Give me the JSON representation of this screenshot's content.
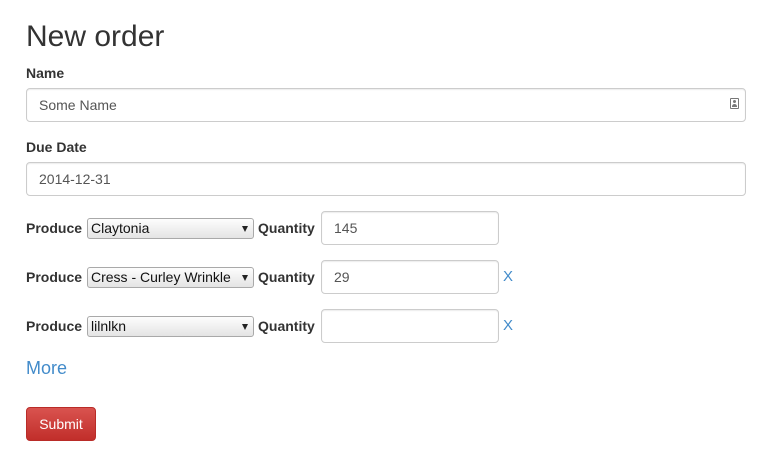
{
  "page": {
    "title": "New order"
  },
  "name_field": {
    "label": "Name",
    "value": "Some Name",
    "icon": "contact-card-icon"
  },
  "due_date_field": {
    "label": "Due Date",
    "value": "2014-12-31"
  },
  "produce_rows": [
    {
      "produce_label": "Produce",
      "produce_selected": "Claytonia",
      "quantity_label": "Quantity",
      "quantity_value": "145",
      "remove_label": ""
    },
    {
      "produce_label": "Produce",
      "produce_selected": "Cress - Curley Wrinkle",
      "quantity_label": "Quantity",
      "quantity_value": "29",
      "remove_label": "X"
    },
    {
      "produce_label": "Produce",
      "produce_selected": "lilnlkn",
      "quantity_label": "Quantity",
      "quantity_value": "",
      "remove_label": "X"
    }
  ],
  "more_link": {
    "label": "More"
  },
  "submit_button": {
    "label": "Submit",
    "color": "#d9534f"
  },
  "colors": {
    "link": "#428bca",
    "text": "#333333",
    "border": "#cccccc"
  }
}
